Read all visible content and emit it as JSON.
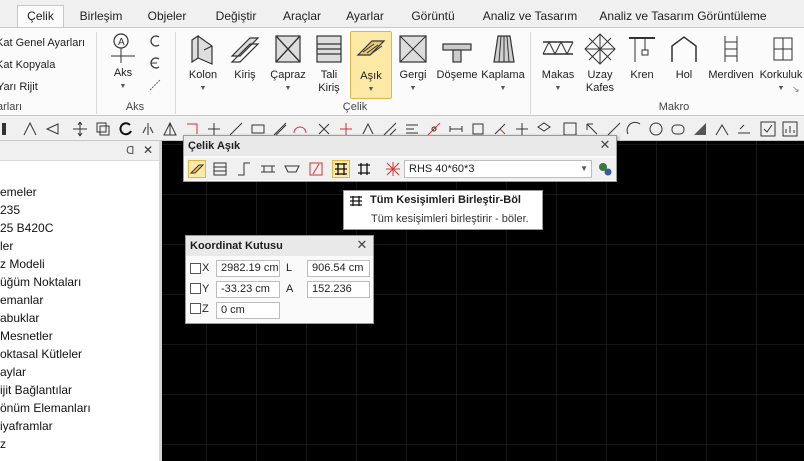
{
  "tabs": [
    "Çelik",
    "Birleşim",
    "Objeler",
    "Değiştir",
    "Araçlar",
    "Ayarlar",
    "Görüntü",
    "Analiz ve Tasarım",
    "Analiz ve Tasarım Görüntüleme"
  ],
  "ribbon": {
    "kat_items": [
      "Kat Genel Ayarları",
      "Kat Kopyala",
      "Yarı Rijit"
    ],
    "kat_group_label": "arları",
    "aks_button": "Aks",
    "aks_group_label": "Aks",
    "celik_buttons": [
      {
        "label": "Kolon"
      },
      {
        "label": "Kiriş"
      },
      {
        "label": "Çapraz"
      },
      {
        "label": "Tali\nKiriş"
      },
      {
        "label": "Aşık"
      },
      {
        "label": "Gergi"
      },
      {
        "label": "Döşeme"
      },
      {
        "label": "Kaplama"
      }
    ],
    "celik_group_label": "Çelik",
    "makro_buttons": [
      {
        "label": "Makas"
      },
      {
        "label": "Uzay\nKafes"
      },
      {
        "label": "Kren"
      },
      {
        "label": "Hol"
      },
      {
        "label": "Merdiven"
      },
      {
        "label": "Korkuluk"
      }
    ],
    "makro_group_label": "Makro"
  },
  "left_panel": {
    "pin_glyph": "ᗡ",
    "close_glyph": "✕",
    "items": [
      "emeler",
      "235",
      "25 B420C",
      "ler",
      "z Modeli",
      "üğüm Noktaları",
      "emanlar",
      "abuklar",
      "Mesnetler",
      "oktasal Kütleler",
      "aylar",
      "ijit Bağlantılar",
      "önüm Elemanları",
      "iyaframlar",
      "z"
    ]
  },
  "celik_asik_panel": {
    "title": "Çelik Aşık",
    "close_glyph": "✕",
    "section_value": "RHS 40*60*3"
  },
  "tooltip": {
    "title": "Tüm Kesişimleri Birleştir-Böl",
    "description": "Tüm kesişimleri birleştirir - böler."
  },
  "koordinat_panel": {
    "title": "Koordinat Kutusu",
    "close_glyph": "✕",
    "x_label": "X",
    "x_value": "2982.19 cm",
    "l_label": "L",
    "l_value": "906.54 cm",
    "y_label": "Y",
    "y_value": "-33.23 cm",
    "a_label": "A",
    "a_value": "152.236",
    "z_label": "Z",
    "z_value": "0 cm"
  },
  "colors": {
    "canvas": "#000000",
    "grid": "#2b2b2b",
    "selected": "#fde9a6",
    "accent_red": "#d0302a"
  }
}
